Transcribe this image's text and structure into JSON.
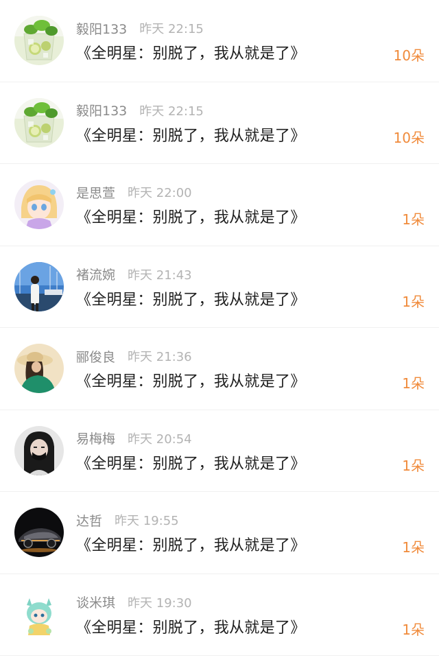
{
  "comments": [
    {
      "username": "毅阳133",
      "time": "昨天 22:15",
      "message": "《全明星：别脱了，我从就是了》",
      "gift": "10朵",
      "avatar_icon": "mojito-drink-avatar"
    },
    {
      "username": "毅阳133",
      "time": "昨天 22:15",
      "message": "《全明星：别脱了，我从就是了》",
      "gift": "10朵",
      "avatar_icon": "mojito-drink-avatar"
    },
    {
      "username": "是思萱",
      "time": "昨天 22:00",
      "message": "《全明星：别脱了，我从就是了》",
      "gift": "1朵",
      "avatar_icon": "anime-girl-avatar"
    },
    {
      "username": "褚流婉",
      "time": "昨天 21:43",
      "message": "《全明星：别脱了，我从就是了》",
      "gift": "1朵",
      "avatar_icon": "harbor-person-avatar"
    },
    {
      "username": "郦俊良",
      "time": "昨天 21:36",
      "message": "《全明星：别脱了，我从就是了》",
      "gift": "1朵",
      "avatar_icon": "woman-sunhat-avatar"
    },
    {
      "username": "易梅梅",
      "time": "昨天 20:54",
      "message": "《全明星：别脱了，我从就是了》",
      "gift": "1朵",
      "avatar_icon": "masked-girl-avatar"
    },
    {
      "username": "达哲",
      "time": "昨天 19:55",
      "message": "《全明星：别脱了，我从就是了》",
      "gift": "1朵",
      "avatar_icon": "sports-car-avatar"
    },
    {
      "username": "谈米琪",
      "time": "昨天 19:30",
      "message": "《全明星：别脱了，我从就是了》",
      "gift": "1朵",
      "avatar_icon": "cartoon-character-avatar"
    }
  ],
  "colors": {
    "username": "#8a8a8a",
    "time": "#b3b3b3",
    "message": "#1f1f1f",
    "gift": "#f08a3a",
    "divider": "#f0f0f0"
  }
}
